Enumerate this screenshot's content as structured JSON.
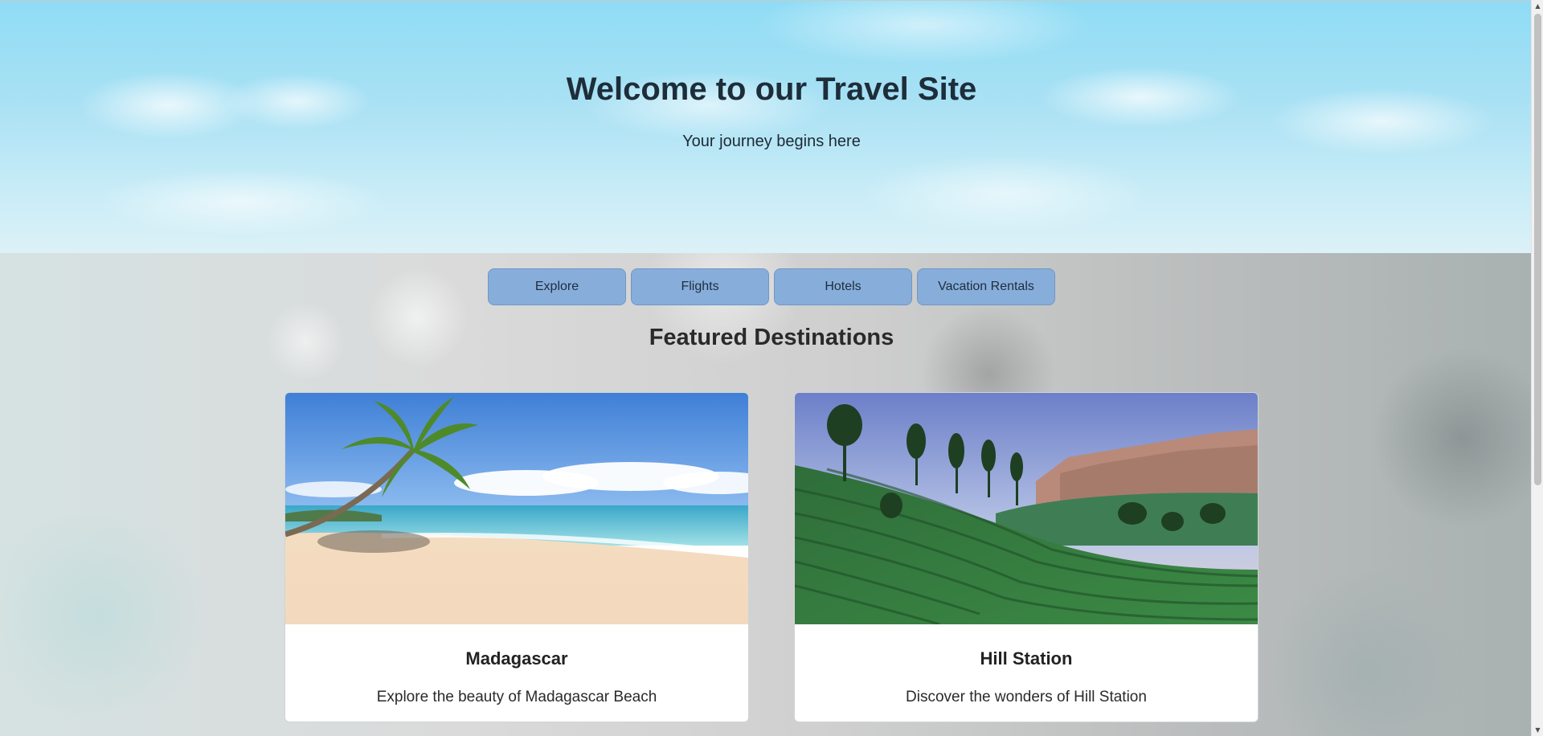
{
  "header": {
    "title": "Welcome to our Travel Site",
    "subtitle": "Your journey begins here"
  },
  "nav": {
    "items": [
      {
        "label": "Explore"
      },
      {
        "label": "Flights"
      },
      {
        "label": "Hotels"
      },
      {
        "label": "Vacation Rentals"
      }
    ]
  },
  "featured": {
    "title": "Featured Destinations",
    "destinations": [
      {
        "name": "Madagascar",
        "description": "Explore the beauty of Madagascar Beach",
        "image": "beach-palm-tree-image"
      },
      {
        "name": "Hill Station",
        "description": "Discover the wonders of Hill Station",
        "image": "tea-plantation-hills-image"
      }
    ]
  },
  "colors": {
    "nav_button": "#87aedb",
    "hero_sky": "#a9e1f4",
    "card_background": "#ffffff"
  },
  "scroll": {
    "up_icon": "▲",
    "down_icon": "▼"
  }
}
